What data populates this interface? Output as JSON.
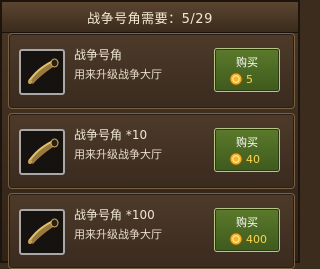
{
  "header": {
    "title": "战争号角需要：5/29"
  },
  "items": [
    {
      "name": "战争号角",
      "desc": "用来升级战争大厅",
      "buy_label": "购买",
      "price": "5",
      "icon": "war-horn-icon"
    },
    {
      "name": "战争号角 *10",
      "desc": "用来升级战争大厅",
      "buy_label": "购买",
      "price": "40",
      "icon": "war-horn-icon"
    },
    {
      "name": "战争号角 *100",
      "desc": "用来升级战争大厅",
      "buy_label": "购买",
      "price": "400",
      "icon": "war-horn-icon"
    }
  ],
  "colors": {
    "button_green": "#4b6a24",
    "price_gold": "#ffd34a",
    "card_border": "#7a6044"
  }
}
